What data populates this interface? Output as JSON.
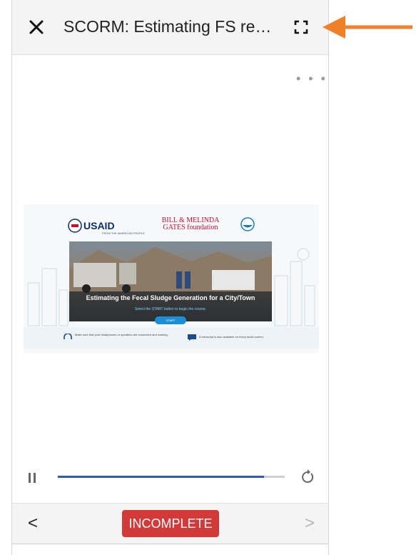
{
  "header": {
    "title": "SCORM: Estimating FS requir...",
    "close_icon": "close-icon",
    "fullscreen_icon": "fullscreen-icon"
  },
  "menu": {
    "more_label": "• • •"
  },
  "slide": {
    "usaid_logo": "USAID",
    "usaid_tagline": "FROM THE AMERICAN PEOPLE",
    "gates_logo_line1": "BILL & MELINDA",
    "gates_logo_line2": "GATES foundation",
    "course_title": "Estimating the Fecal Sludge Generation for a City/Town",
    "instruction": "Select the START button to begin the course.",
    "start_label": "START",
    "note_headphones": "Make sure that your headphones or speakers are connected and working.",
    "note_transcript": "A transcript is also available on every audio screen."
  },
  "player": {
    "progress_fraction": 0.91,
    "pause_icon": "pause-icon",
    "replay_icon": "replay-icon"
  },
  "footer": {
    "prev_label": "<",
    "status_label": "INCOMPLETE",
    "next_label": ">"
  },
  "colors": {
    "accent_arrow": "#f07f2a",
    "status_red": "#d23a3a",
    "progress_blue": "#2c5ea8"
  }
}
